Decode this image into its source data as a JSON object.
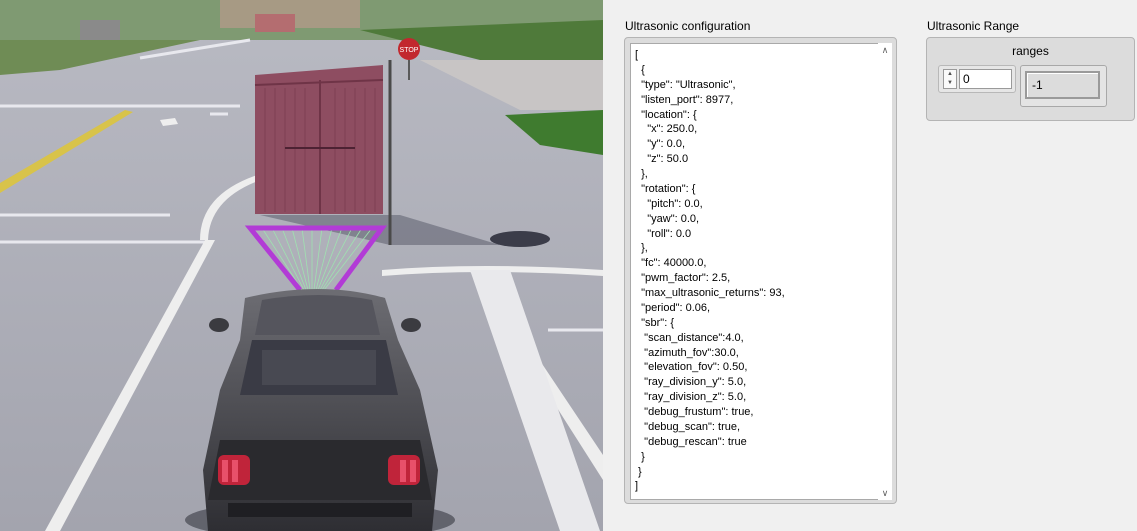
{
  "scene": {
    "stop_sign_text": "STOP",
    "colors": {
      "frustum": "#b23bd6",
      "rays": "#9fe2b0",
      "container": "#8e4d61"
    }
  },
  "config": {
    "label": "Ultrasonic configuration",
    "text": "[\n  {\n  \"type\": \"Ultrasonic\",\n  \"listen_port\": 8977,\n  \"location\": {\n    \"x\": 250.0,\n    \"y\": 0.0,\n    \"z\": 50.0\n  },\n  \"rotation\": {\n    \"pitch\": 0.0,\n    \"yaw\": 0.0,\n    \"roll\": 0.0\n  },\n  \"fc\": 40000.0,\n  \"pwm_factor\": 2.5,\n  \"max_ultrasonic_returns\": 93,\n  \"period\": 0.06,\n  \"sbr\": {\n   \"scan_distance\":4.0,\n   \"azimuth_fov\":30.0,\n   \"elevation_fov\": 0.50,\n   \"ray_division_y\": 5.0,\n   \"ray_division_z\": 5.0,\n   \"debug_frustum\": true,\n   \"debug_scan\": true,\n   \"debug_rescan\": true\n  }\n }\n]",
    "scroll_up_icon": "chevron-up-icon",
    "scroll_down_icon": "chevron-down-icon"
  },
  "range": {
    "label": "Ultrasonic Range",
    "caption": "ranges",
    "index_value": "0",
    "value": "-1"
  }
}
